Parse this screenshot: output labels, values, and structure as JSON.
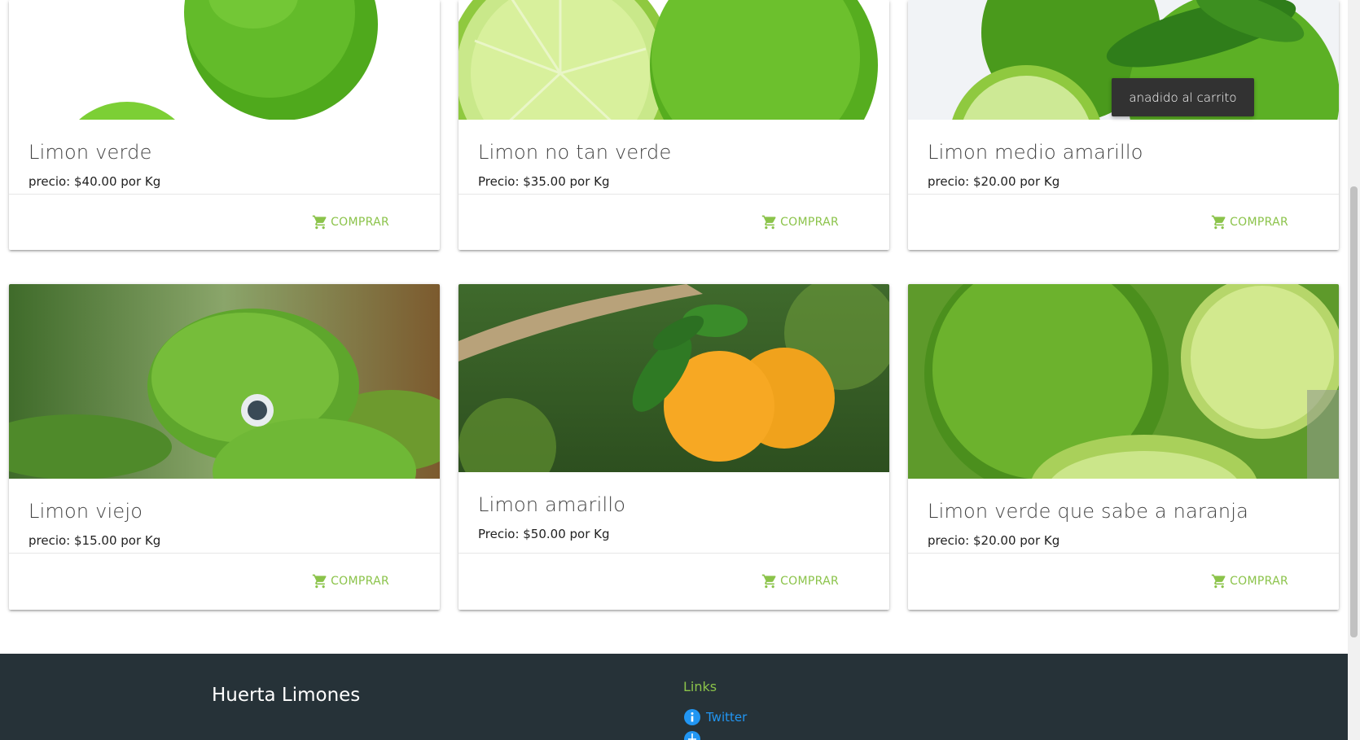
{
  "products": [
    {
      "name": "Limon verde",
      "price": "precio: $40.00 por Kg",
      "buy_label": "COMPRAR"
    },
    {
      "name": "Limon no tan verde",
      "price": "Precio: $35.00 por Kg",
      "buy_label": "COMPRAR"
    },
    {
      "name": "Limon medio amarillo",
      "price": "precio: $20.00 por Kg",
      "buy_label": "COMPRAR"
    },
    {
      "name": "Limon viejo",
      "price": "precio: $15.00 por Kg",
      "buy_label": "COMPRAR"
    },
    {
      "name": "Limon amarillo",
      "price": "Precio: $50.00 por Kg",
      "buy_label": "COMPRAR"
    },
    {
      "name": "Limon verde que sabe a naranja",
      "price": "precio: $20.00 por Kg",
      "buy_label": "COMPRAR"
    }
  ],
  "toast": {
    "text": "anadido al carrito"
  },
  "footer": {
    "title": "Huerta Limones",
    "links_heading": "Links",
    "links": [
      {
        "label": "Twitter",
        "icon": "info-icon"
      },
      {
        "label": "",
        "icon": "globe-icon"
      }
    ]
  },
  "colors": {
    "accent": "#8bc34a",
    "footer_bg": "#263238",
    "link": "#2196f3",
    "toast_bg": "#323232"
  }
}
